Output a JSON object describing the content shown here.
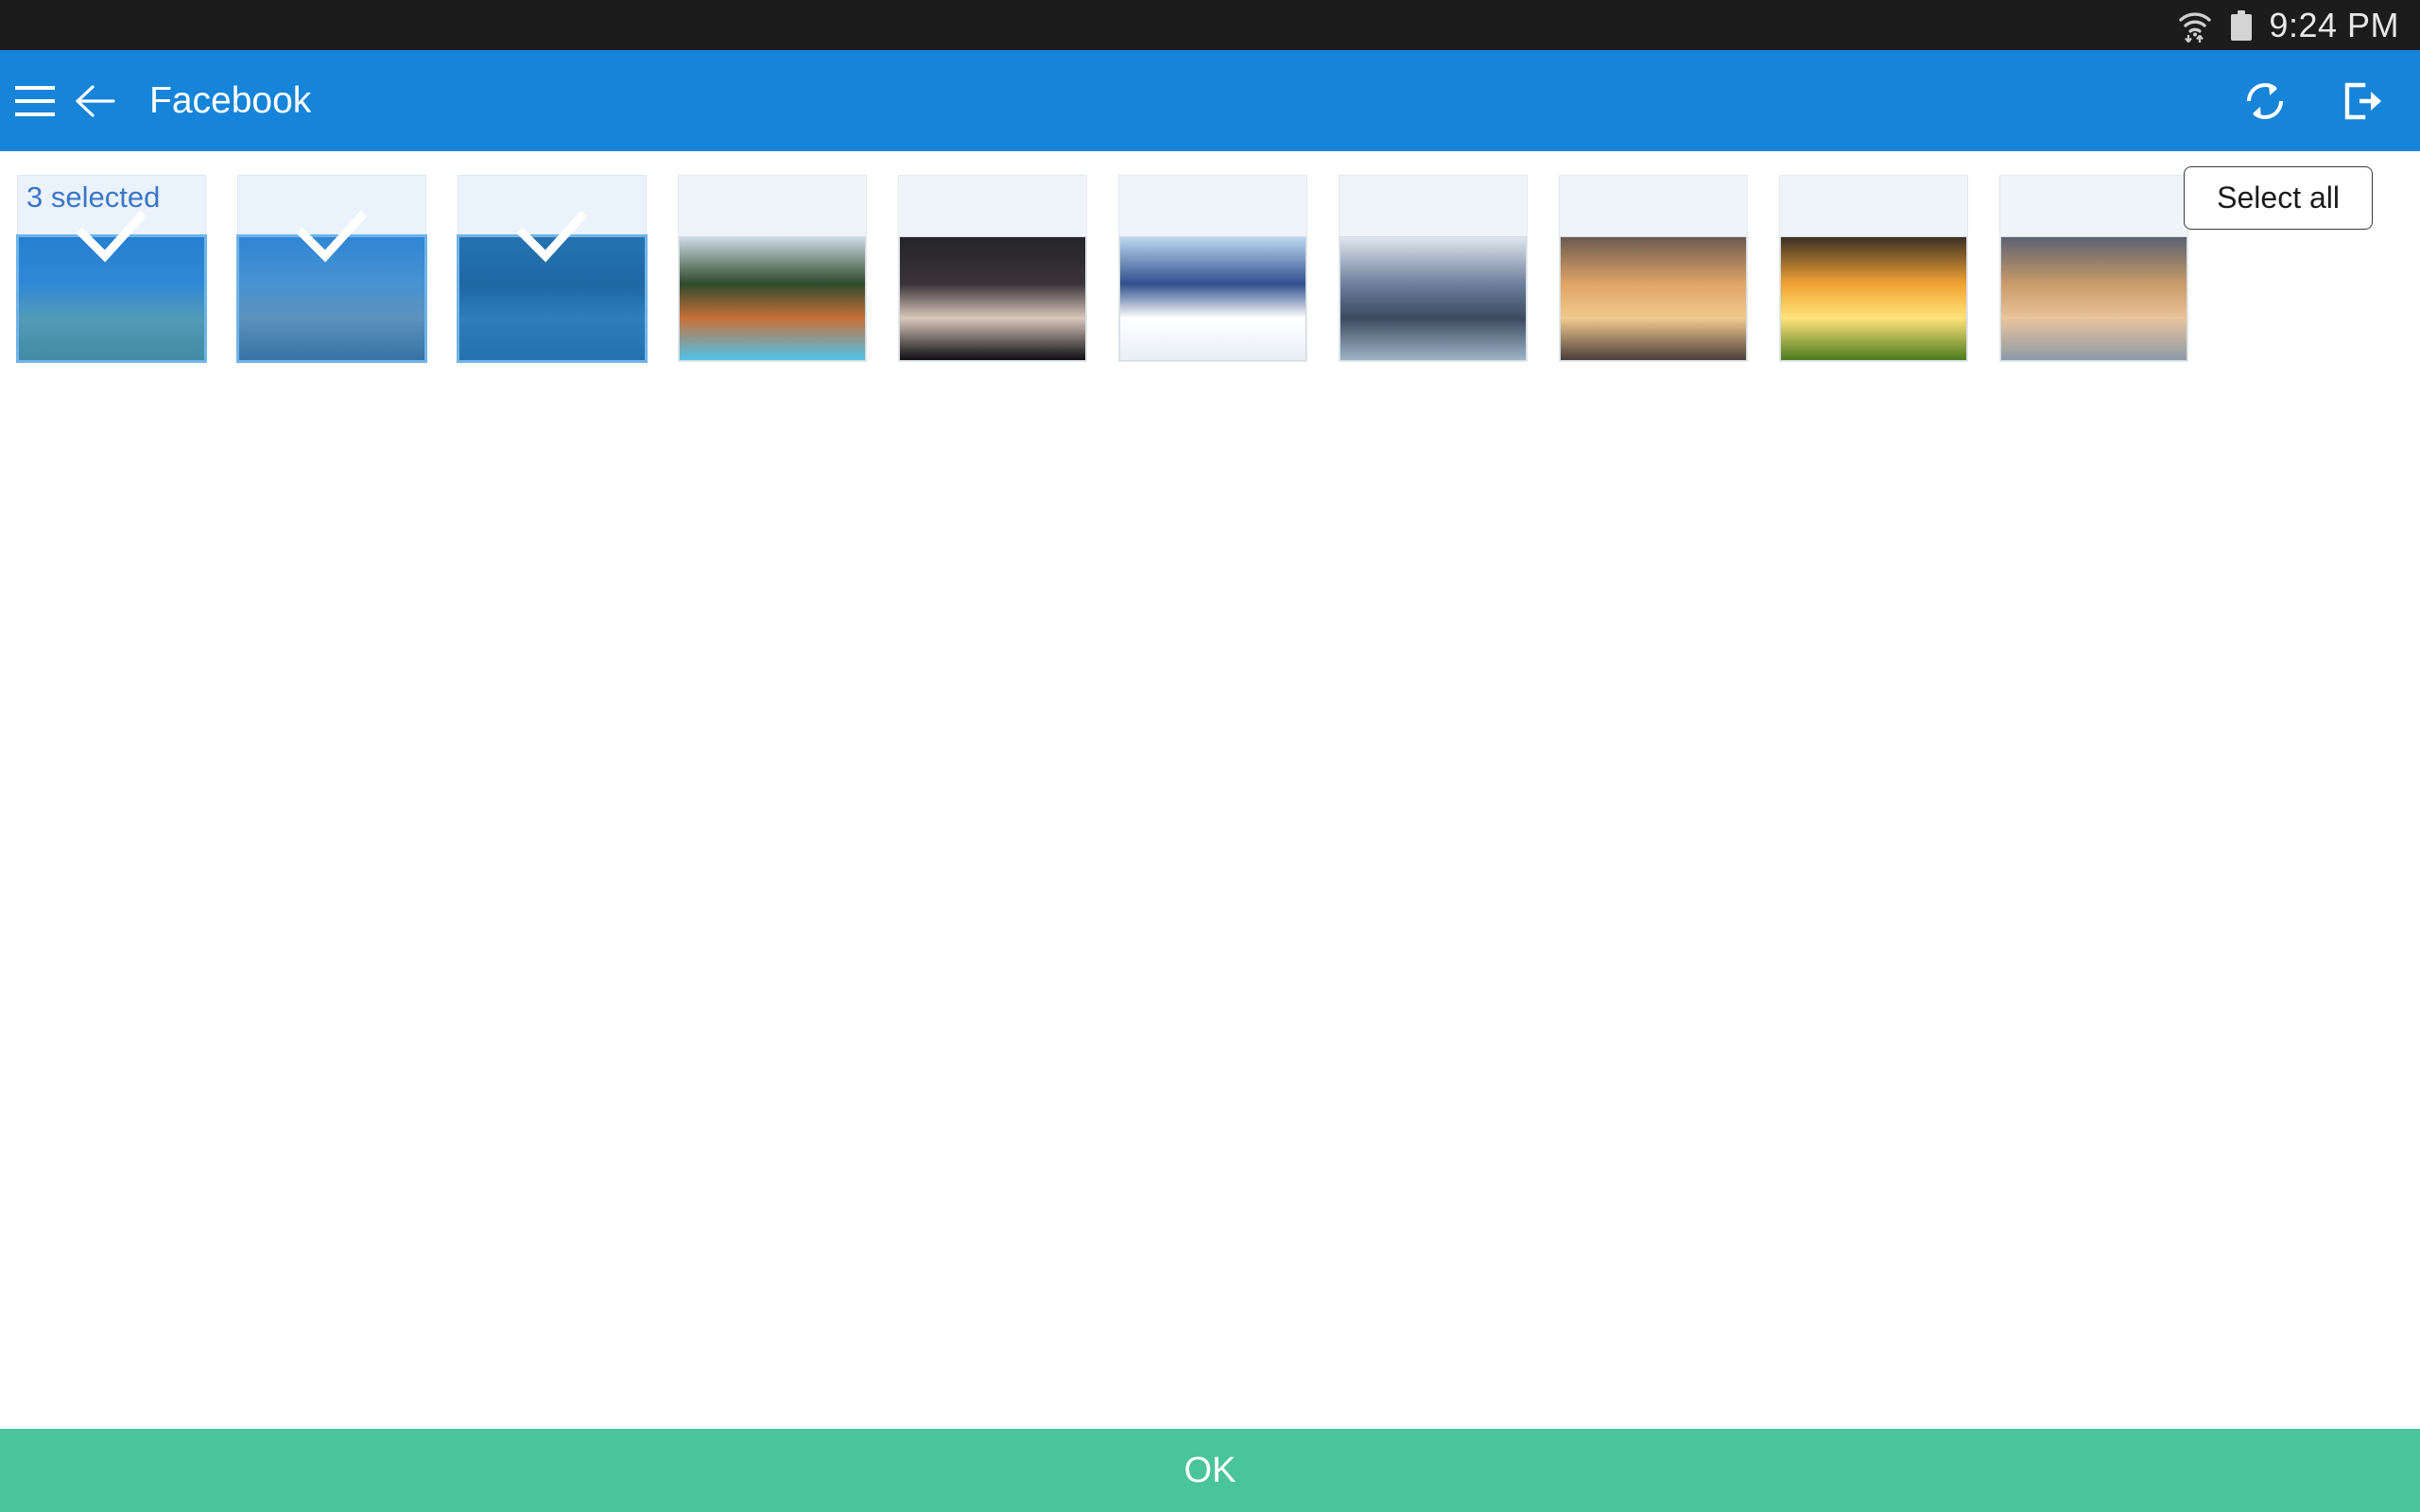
{
  "status_bar": {
    "wifi_icon": "wifi-icon",
    "battery_icon": "battery-icon",
    "time": "9:24 PM"
  },
  "app_bar": {
    "menu_icon": "hamburger-menu-icon",
    "back_icon": "back-arrow-icon",
    "title": "Facebook",
    "refresh_icon": "refresh-sync-icon",
    "logout_icon": "logout-export-icon"
  },
  "gallery": {
    "selection_label": "3 selected",
    "select_all_label": "Select all",
    "selected_count": 3,
    "total_count": 10,
    "checkmark_icon": "checkmark-icon",
    "photos": [
      {
        "name": "blue-sky-grass-field",
        "selected": true,
        "colors": [
          "#2d86d8",
          "#3f97e0",
          "#7fb7a8",
          "#5e9c86"
        ]
      },
      {
        "name": "desert-highway-with-flag",
        "selected": true,
        "colors": [
          "#3f93dd",
          "#6aa9d8",
          "#8fa9b4",
          "#4a6f86"
        ]
      },
      {
        "name": "glacier-iceberg-lake",
        "selected": true,
        "colors": [
          "#2c6f9e",
          "#1f5b85",
          "#3d83ad",
          "#2a6d96"
        ]
      },
      {
        "name": "yellowstone-hot-spring",
        "selected": false,
        "colors": [
          "#cfd9e4",
          "#2e4a2c",
          "#c8703a",
          "#4fc3e8"
        ]
      },
      {
        "name": "night-lightning-storm",
        "selected": false,
        "colors": [
          "#242428",
          "#3a3438",
          "#d8c7bc",
          "#0d0d10"
        ]
      },
      {
        "name": "snow-covered-mountain-peak",
        "selected": false,
        "colors": [
          "#bcd8ef",
          "#30508c",
          "#ffffff",
          "#e8eef6"
        ]
      },
      {
        "name": "winter-lake-reflection",
        "selected": false,
        "colors": [
          "#dfe6ee",
          "#6f7f9c",
          "#3c4a60",
          "#9fb4c8"
        ]
      },
      {
        "name": "golden-storm-clouds",
        "selected": false,
        "colors": [
          "#6b5a52",
          "#e0a464",
          "#f0c98f",
          "#4a3f3c"
        ]
      },
      {
        "name": "green-hillside-sunset",
        "selected": false,
        "colors": [
          "#3a3024",
          "#f2a333",
          "#ffe27a",
          "#4c7a1e"
        ]
      },
      {
        "name": "golden-cloudscape",
        "selected": false,
        "colors": [
          "#5b6272",
          "#c99a6a",
          "#e8c49a",
          "#8d9aa8"
        ]
      }
    ]
  },
  "bottom_bar": {
    "ok_label": "OK",
    "accent_color": "#4ac49a"
  },
  "theme": {
    "status_bar_color": "#1c1c1c",
    "app_bar_color": "#1684d8",
    "selection_text_color": "#3b76c9",
    "ok_bar_color": "#4ac49a",
    "page_background": "#ffffff"
  }
}
